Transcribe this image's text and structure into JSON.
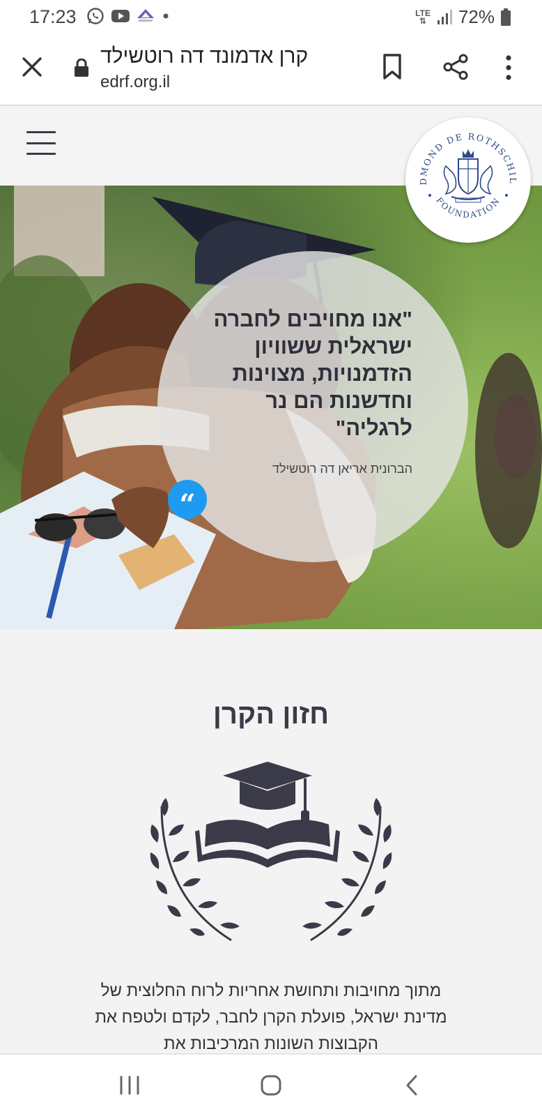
{
  "status_bar": {
    "time": "17:23",
    "network": "LTE",
    "battery": "72%",
    "notification_icons": [
      "whatsapp-icon",
      "youtube-icon",
      "app-icon",
      "dot-icon"
    ]
  },
  "browser": {
    "page_title": "קרן אדמונד דה רוטשילד",
    "url": "edrf.org.il"
  },
  "header": {
    "logo_text_top": "EDMOND DE ROTHSCHILD",
    "logo_text_bottom": "FOUNDATION"
  },
  "hero": {
    "quote": "\"אנו מחויבים לחברה ישראלית ששוויון הזדמנויות, מצוינות וחדשנות הם נר לרגליה\"",
    "author": "הברונית אריאן דה רוטשילד",
    "quote_icon_color": "#1e9bf0"
  },
  "vision": {
    "title": "חזון הקרן",
    "body": "מתוך מחויבות ותחושת אחריות לרוח החלוצית של מדינת ישראל, פועלת הקרן לחבר, לקדם ולטפח את הקבוצות השונות המרכיבות את"
  },
  "colors": {
    "accent": "#1e9bf0",
    "dark": "#3a3a48",
    "logo_blue": "#2d4a8a"
  }
}
